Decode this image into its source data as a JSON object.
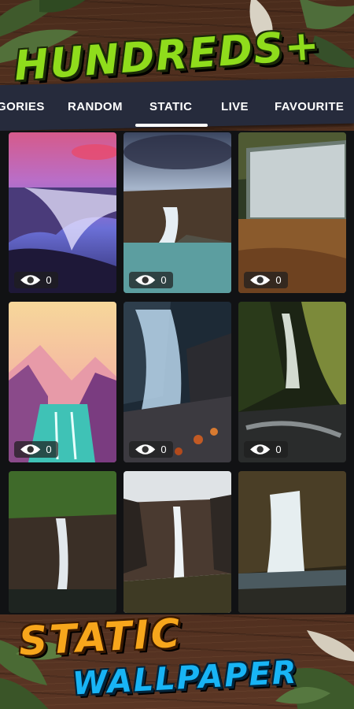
{
  "promo": {
    "top_title": "HUNDREDS+",
    "bottom_line1": "STATIC",
    "bottom_line2": "WALLPAPER"
  },
  "tabs": [
    {
      "label": "GORIES"
    },
    {
      "label": "RANDOM"
    },
    {
      "label": "STATIC",
      "active": true
    },
    {
      "label": "LIVE"
    },
    {
      "label": "FAVOURITE"
    }
  ],
  "wallpapers": [
    {
      "views": "0"
    },
    {
      "views": "0"
    },
    {
      "views": "0"
    },
    {
      "views": "0"
    },
    {
      "views": "0"
    },
    {
      "views": "0"
    },
    {
      "views": null
    },
    {
      "views": null
    },
    {
      "views": null
    }
  ],
  "colors": {
    "tabbar": "#262b3c",
    "title_green": "#8fdc1c",
    "title_orange": "#f7a61c",
    "title_blue": "#18b4f5"
  },
  "icons": {
    "view_count": "eye-icon"
  }
}
